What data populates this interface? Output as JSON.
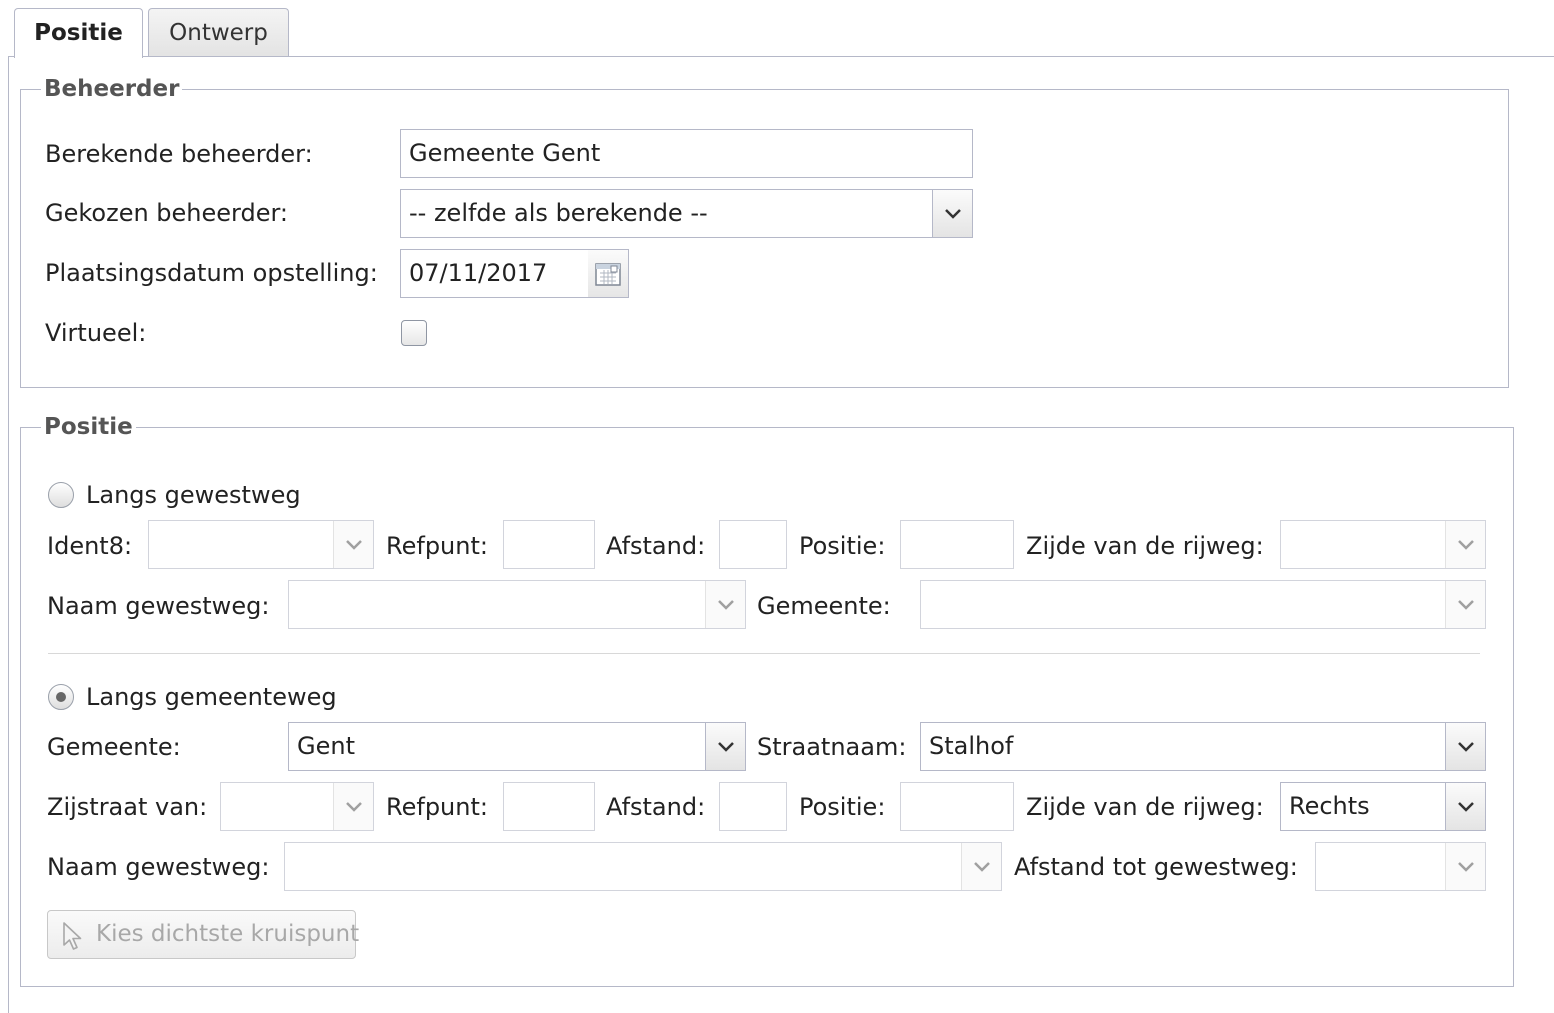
{
  "tabs": [
    {
      "label": "Positie",
      "active": true
    },
    {
      "label": "Ontwerp",
      "active": false
    }
  ],
  "beheerder": {
    "legend": "Beheerder",
    "berekende_label": "Berekende beheerder:",
    "berekende_value": "Gemeente Gent",
    "gekozen_label": "Gekozen beheerder:",
    "gekozen_value": "-- zelfde als berekende --",
    "datum_label": "Plaatsingsdatum opstelling:",
    "datum_value": "07/11/2017",
    "virtueel_label": "Virtueel:",
    "virtueel_checked": false
  },
  "positie": {
    "legend": "Positie",
    "gewestweg": {
      "radio_label": "Langs gewestweg",
      "selected": false,
      "ident8_label": "Ident8:",
      "ident8_value": "",
      "refpunt_label": "Refpunt:",
      "refpunt_value": "",
      "afstand_label": "Afstand:",
      "afstand_value": "",
      "positie_label": "Positie:",
      "positie_value": "",
      "zijde_label": "Zijde van de rijweg:",
      "zijde_value": "",
      "naam_label": "Naam gewestweg:",
      "naam_value": "",
      "gemeente_label": "Gemeente:",
      "gemeente_value": ""
    },
    "gemeenteweg": {
      "radio_label": "Langs gemeenteweg",
      "selected": true,
      "gemeente_label": "Gemeente:",
      "gemeente_value": "Gent",
      "straatnaam_label": "Straatnaam:",
      "straatnaam_value": "Stalhof",
      "zijstraat_label": "Zijstraat van:",
      "zijstraat_value": "",
      "refpunt_label": "Refpunt:",
      "refpunt_value": "",
      "afstand_label": "Afstand:",
      "afstand_value": "",
      "positie_label": "Positie:",
      "positie_value": "",
      "zijde_label": "Zijde van de rijweg:",
      "zijde_value": "Rechts",
      "naam_label": "Naam gewestweg:",
      "naam_value": "",
      "afstand_tot_label": "Afstand tot gewestweg:",
      "afstand_tot_value": ""
    },
    "kruispunt_button": "Kies dichtste kruispunt"
  },
  "icons": {
    "dropdown": "chevron-down-icon",
    "calendar": "calendar-icon",
    "pointer": "cursor-pointer-icon"
  },
  "colors": {
    "border": "#b5b8c8",
    "legend_text": "#555555",
    "disabled_text": "#a8a8a8"
  }
}
